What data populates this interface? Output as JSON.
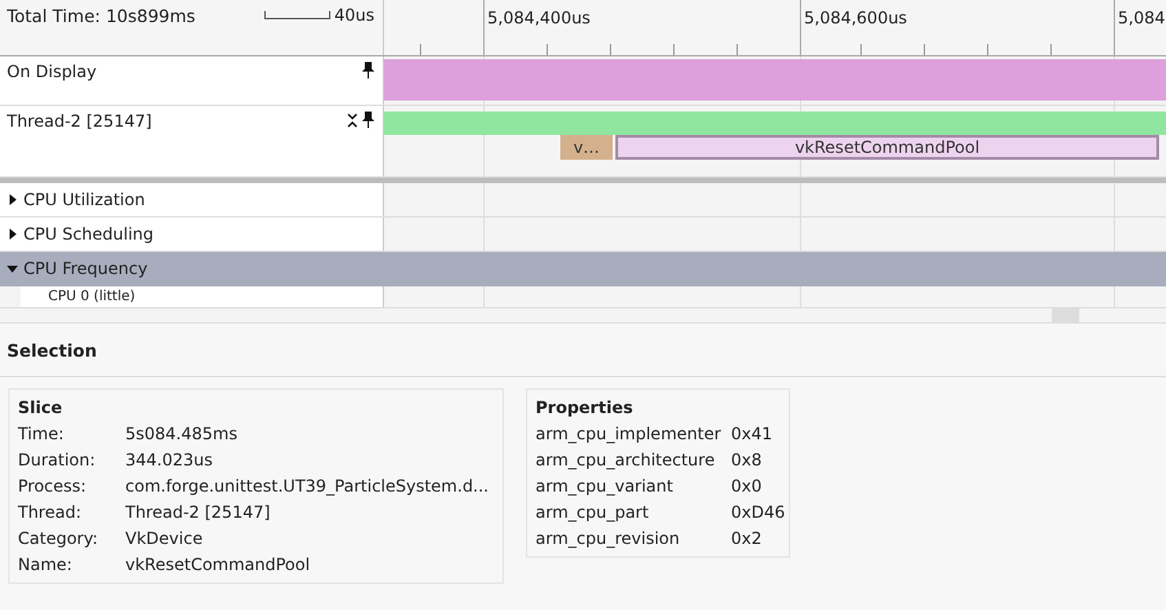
{
  "header": {
    "total_time": "Total Time: 10s899ms",
    "scale_label": "40us",
    "ticks": [
      "5,084,400us",
      "5,084,600us",
      "5,084"
    ]
  },
  "tracks": [
    {
      "kind": "display",
      "label": "On Display",
      "pinned": true
    },
    {
      "kind": "thread",
      "label": "Thread-2 [25147]",
      "pinned": true,
      "slices": [
        {
          "name": "v…",
          "color": "#d4b08c",
          "selected": false
        },
        {
          "name": "vkResetCommandPool",
          "color": "#edd4ee",
          "selected": true
        }
      ]
    }
  ],
  "groups": [
    {
      "label": "CPU Utilization",
      "expanded": false
    },
    {
      "label": "CPU Scheduling",
      "expanded": false
    },
    {
      "label": "CPU Frequency",
      "expanded": true,
      "children": [
        {
          "label": "CPU 0 (little)"
        }
      ]
    }
  ],
  "selection": {
    "title": "Selection",
    "slice": {
      "title": "Slice",
      "rows": [
        {
          "key": "Time:",
          "value": "5s084.485ms"
        },
        {
          "key": "Duration:",
          "value": "344.023us"
        },
        {
          "key": "Process:",
          "value": "com.forge.unittest.UT39_ParticleSystem.d..."
        },
        {
          "key": "Thread:",
          "value": "Thread-2 [25147]"
        },
        {
          "key": "Category:",
          "value": "VkDevice"
        },
        {
          "key": "Name:",
          "value": "vkResetCommandPool"
        }
      ]
    },
    "properties": {
      "title": "Properties",
      "rows": [
        {
          "key": "arm_cpu_implementer",
          "value": "0x41"
        },
        {
          "key": "arm_cpu_architecture",
          "value": "0x8"
        },
        {
          "key": "arm_cpu_variant",
          "value": "0x0"
        },
        {
          "key": "arm_cpu_part",
          "value": "0xD46"
        },
        {
          "key": "arm_cpu_revision",
          "value": "0x2"
        }
      ]
    }
  }
}
